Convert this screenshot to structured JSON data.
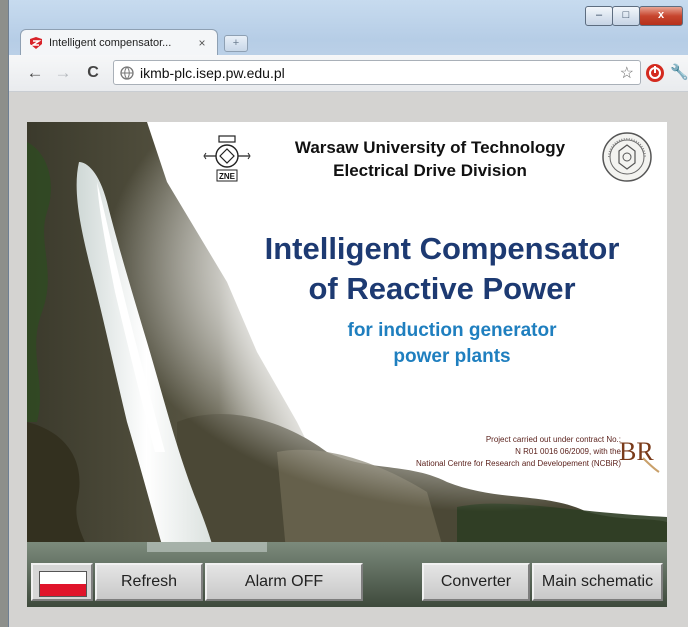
{
  "browser": {
    "tab_title": "Intelligent compensator...",
    "tab_close": "×",
    "new_tab": "+",
    "url": "ikmb-plc.isep.pw.edu.pl",
    "back_glyph": "←",
    "forward_glyph": "→",
    "reload_glyph": "C",
    "star_glyph": "☆",
    "wrench_glyph": "🔧",
    "window_min": "–",
    "window_max": "□",
    "window_close": "x"
  },
  "page": {
    "university": "Warsaw University of Technology",
    "division": "Electrical Drive Division",
    "zne_label": "ZNE",
    "title_line1": "Intelligent Compensator",
    "title_line2": "of Reactive Power",
    "subtitle_line1": "for induction generator",
    "subtitle_line2": "power plants",
    "project_line1": "Project carried out under contract No.:",
    "project_line2": "N  R01 0016 06/2009, with the",
    "project_line3": "National Centre for Research and Developement (NCBiR)",
    "br_logo_text": "BR"
  },
  "buttons": {
    "refresh": "Refresh",
    "alarm": "Alarm OFF",
    "converter": "Converter",
    "main_schematic": "Main schematic"
  },
  "colors": {
    "title_blue": "#1d3a72",
    "subtitle_blue": "#1f7fbf",
    "flag_red": "#e0142a"
  }
}
